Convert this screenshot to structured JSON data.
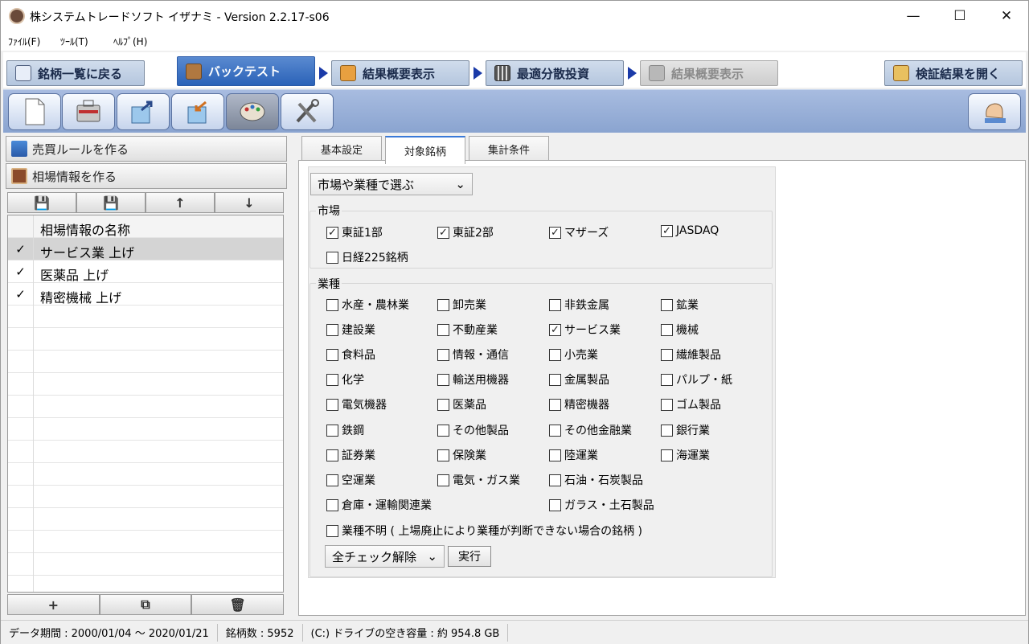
{
  "window": {
    "title": "株システムトレードソフト イザナミ - Version 2.2.17-s06",
    "minimize_glyph": "—",
    "maximize_glyph": "☐",
    "close_glyph": "✕"
  },
  "menu": [
    {
      "label": "ﾌｧｲﾙ(F)"
    },
    {
      "label": "ﾂｰﾙ(T)"
    },
    {
      "label": "ﾍﾙﾌﾟ(H)"
    }
  ],
  "nav_tabs": [
    {
      "label": "銘柄一覧に戻る",
      "icon": "eye-icon"
    },
    {
      "label": "バックテスト",
      "icon": "bag-icon"
    },
    {
      "label": "結果概要表示",
      "icon": "thumbs-up-icon"
    },
    {
      "label": "最適分散投資",
      "icon": "calculator-icon"
    },
    {
      "label": "結果概要表示",
      "icon": "factory-icon"
    },
    {
      "label": "検証結果を開く",
      "icon": "open-folder-icon"
    }
  ],
  "toolbar": {
    "buttons": [
      "new-document-icon",
      "briefcase-icon",
      "export-icon",
      "import-icon",
      "palette-icon",
      "tools-icon"
    ],
    "right_button": "hand-icon"
  },
  "left_panel": {
    "btn_rule": "売買ルールを作る",
    "btn_market": "相場情報を作る",
    "tools": [
      "💾",
      "💾",
      "↑",
      "↓"
    ],
    "list_header": "相場情報の名称",
    "items": [
      {
        "name": "サービス業 上げ",
        "checked": "✓"
      },
      {
        "name": "医薬品 上げ",
        "checked": "✓"
      },
      {
        "name": "精密機械 上げ",
        "checked": "✓"
      }
    ],
    "bottom_tools": [
      "+",
      "⧉",
      "🗑"
    ]
  },
  "right_tabs": [
    "基本設定",
    "対象銘柄",
    "集計条件"
  ],
  "selector": {
    "value": "市場や業種で選ぶ",
    "arrow": "⌄"
  },
  "market_group": {
    "label": "市場",
    "items": [
      {
        "label": "東証1部",
        "mark": "✓"
      },
      {
        "label": "東証2部",
        "mark": "✓"
      },
      {
        "label": "マザーズ",
        "mark": "✓"
      },
      {
        "label": "JASDAQ",
        "mark": "✓"
      },
      {
        "label": "日経225銘柄",
        "mark": ""
      }
    ]
  },
  "industry_group": {
    "label": "業種",
    "items": [
      {
        "label": "水産・農林業",
        "mark": ""
      },
      {
        "label": "卸売業",
        "mark": ""
      },
      {
        "label": "非鉄金属",
        "mark": ""
      },
      {
        "label": "鉱業",
        "mark": ""
      },
      {
        "label": "建設業",
        "mark": ""
      },
      {
        "label": "不動産業",
        "mark": ""
      },
      {
        "label": "サービス業",
        "mark": "✓"
      },
      {
        "label": "機械",
        "mark": ""
      },
      {
        "label": "食料品",
        "mark": ""
      },
      {
        "label": "情報・通信",
        "mark": ""
      },
      {
        "label": "小売業",
        "mark": ""
      },
      {
        "label": "繊維製品",
        "mark": ""
      },
      {
        "label": "化学",
        "mark": ""
      },
      {
        "label": "輸送用機器",
        "mark": ""
      },
      {
        "label": "金属製品",
        "mark": ""
      },
      {
        "label": "パルプ・紙",
        "mark": ""
      },
      {
        "label": "電気機器",
        "mark": ""
      },
      {
        "label": "医薬品",
        "mark": ""
      },
      {
        "label": "精密機器",
        "mark": ""
      },
      {
        "label": "ゴム製品",
        "mark": ""
      },
      {
        "label": "鉄鋼",
        "mark": ""
      },
      {
        "label": "その他製品",
        "mark": ""
      },
      {
        "label": "その他金融業",
        "mark": ""
      },
      {
        "label": "銀行業",
        "mark": ""
      },
      {
        "label": "証券業",
        "mark": ""
      },
      {
        "label": "保険業",
        "mark": ""
      },
      {
        "label": "陸運業",
        "mark": ""
      },
      {
        "label": "海運業",
        "mark": ""
      },
      {
        "label": "空運業",
        "mark": ""
      },
      {
        "label": "電気・ガス業",
        "mark": ""
      },
      {
        "label": "石油・石炭製品",
        "mark": ""
      },
      {
        "label": "倉庫・運輸関連業",
        "mark": ""
      },
      {
        "label": "ガラス・土石製品",
        "mark": ""
      },
      {
        "label": "業種不明 ( 上場廃止により業種が判断できない場合の銘柄 )",
        "mark": ""
      }
    ]
  },
  "bulk": {
    "value": "全チェック解除",
    "arrow": "⌄",
    "exec_label": "実行"
  },
  "status": {
    "period": "データ期間 : 2000/01/04 〜 2020/01/21",
    "count": "銘柄数 : 5952",
    "disk": "(C:) ドライブの空き容量 : 約 954.8 GB"
  },
  "colors": {
    "nav_active": "#2a62b8",
    "nav_arrow": "#1a3aa8",
    "toolbar_bg": "#8aa4d0",
    "tab_accent": "#3a7ad8"
  }
}
